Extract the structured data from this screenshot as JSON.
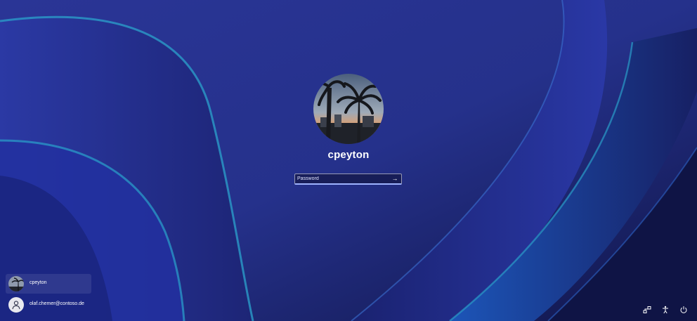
{
  "lock_screen": {
    "username": "cpeyton",
    "password_field": {
      "value": "",
      "placeholder": "Password",
      "submit_icon": "arrow-right-icon"
    }
  },
  "user_list": [
    {
      "name": "cpeyton",
      "avatar": "palm-tree-photo",
      "selected": true
    },
    {
      "name": "olaf.chemer@contoso.de",
      "avatar": "generic-user-icon",
      "selected": false
    }
  ],
  "system_icons": [
    "network-icon",
    "accessibility-icon",
    "power-icon"
  ],
  "colors": {
    "background": "#27338f",
    "wave_accent": "#2a9bc8",
    "text": "#ffffff"
  }
}
